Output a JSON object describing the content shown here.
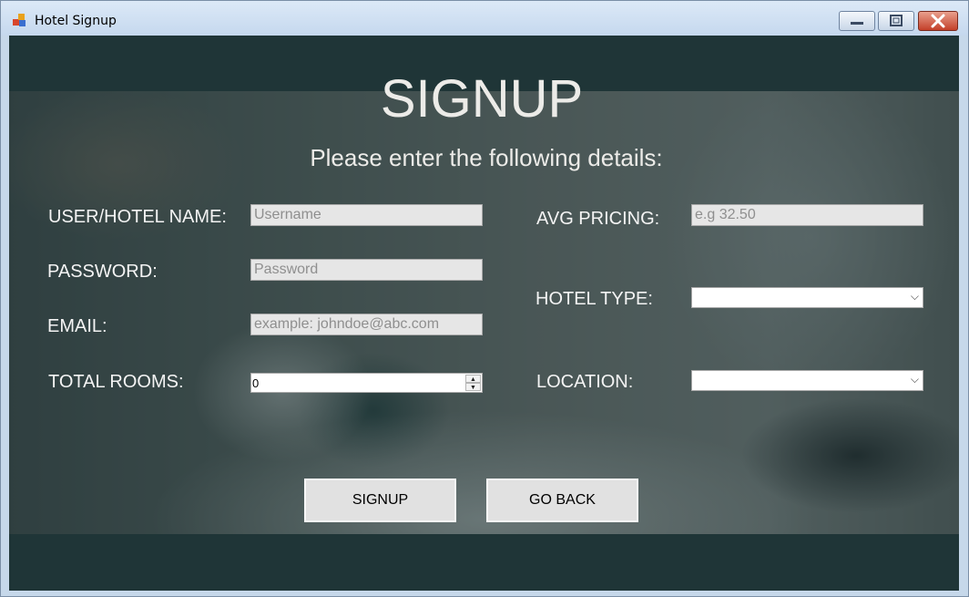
{
  "window": {
    "title": "Hotel Signup"
  },
  "header": {
    "title": "SIGNUP",
    "subtitle": "Please enter the following details:"
  },
  "form": {
    "username": {
      "label": "USER/HOTEL NAME:",
      "placeholder": "Username"
    },
    "password": {
      "label": "PASSWORD:",
      "placeholder": "Password"
    },
    "email": {
      "label": "EMAIL:",
      "placeholder": "example: johndoe@abc.com"
    },
    "total_rooms": {
      "label": "TOTAL ROOMS:",
      "value": "0"
    },
    "avg_pricing": {
      "label": "AVG PRICING:",
      "placeholder": "e.g 32.50"
    },
    "hotel_type": {
      "label": "HOTEL TYPE:",
      "value": ""
    },
    "location": {
      "label": "LOCATION:",
      "value": ""
    }
  },
  "buttons": {
    "signup": "SIGNUP",
    "go_back": "GO BACK"
  },
  "icons": {
    "minimize": "minimize-icon",
    "maximize": "maximize-icon",
    "close": "close-icon",
    "app": "app-icon"
  },
  "colors": {
    "background": "#1f3537",
    "text": "#ecebe8",
    "input": "#e6e6e6",
    "button": "#e1e1e1"
  }
}
